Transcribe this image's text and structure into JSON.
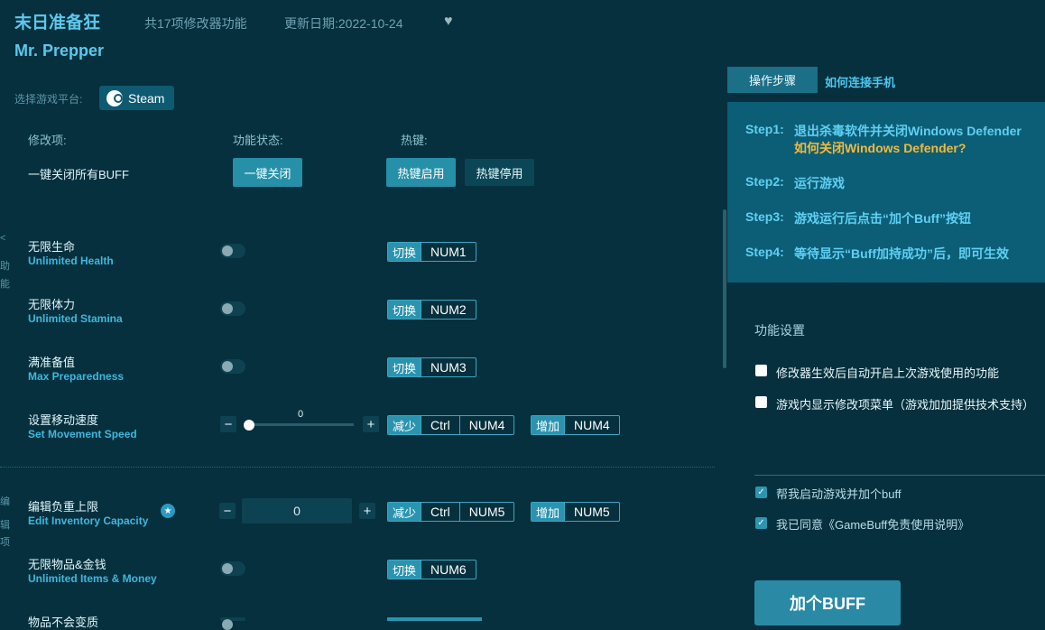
{
  "header": {
    "title": "末日准备狂",
    "subtitle": "Mr. Prepper",
    "feature_count": "共17项修改器功能",
    "update_date": "更新日期:2022-10-24"
  },
  "platform": {
    "label": "选择游戏平台:",
    "name": "Steam"
  },
  "columns": {
    "item": "修改项:",
    "status": "功能状态:",
    "hotkey": "热键:"
  },
  "master": {
    "label": "一键关闭所有BUFF",
    "close_all": "一键关闭",
    "hotkey_on": "热键启用",
    "hotkey_off": "热键停用"
  },
  "edge_chars": [
    "<",
    "助",
    "能",
    "编",
    "辑",
    "项"
  ],
  "rows": [
    {
      "cn": "无限生命",
      "en": "Unlimited Health",
      "tag": "切换",
      "key": "NUM1"
    },
    {
      "cn": "无限体力",
      "en": "Unlimited Stamina",
      "tag": "切换",
      "key": "NUM2"
    },
    {
      "cn": "满准备值",
      "en": "Max Preparedness",
      "tag": "切换",
      "key": "NUM3"
    },
    {
      "cn": "设置移动速度",
      "en": "Set Movement Speed",
      "value": "0",
      "dec_tag": "减少",
      "dec_mod": "Ctrl",
      "dec_key": "NUM4",
      "inc_tag": "增加",
      "inc_key": "NUM4",
      "slider_fraction": 0
    },
    {
      "cn": "编辑负重上限",
      "en": "Edit Inventory Capacity",
      "value": "0",
      "dec_tag": "减少",
      "dec_mod": "Ctrl",
      "dec_key": "NUM5",
      "inc_tag": "增加",
      "inc_key": "NUM5"
    },
    {
      "cn": "无限物品&金钱",
      "en": "Unlimited Items & Money",
      "tag": "切换",
      "key": "NUM6"
    },
    {
      "cn": "物品不会变质",
      "en": ""
    }
  ],
  "stepper": {
    "minus": "−",
    "plus": "+"
  },
  "right": {
    "tab_steps": "操作步骤",
    "tab_phone": "如何连接手机",
    "steps": [
      {
        "label": "Step1:",
        "text": "退出杀毒软件并关闭Windows Defender",
        "link": "如何关闭Windows Defender?"
      },
      {
        "label": "Step2:",
        "text": "运行游戏"
      },
      {
        "label": "Step3:",
        "text": "游戏运行后点击“加个Buff”按钮"
      },
      {
        "label": "Step4:",
        "text": "等待显示“Buff加持成功”后，即可生效"
      }
    ],
    "settings_title": "功能设置",
    "options": [
      {
        "text": "修改器生效后自动开启上次游戏使用的功能",
        "checked": false
      },
      {
        "text": "游戏内显示修改项菜单（游戏加加提供技术支持）",
        "checked": false
      }
    ],
    "agreements": [
      {
        "text": "帮我启动游戏并加个buff",
        "checked": true
      },
      {
        "text": "我已同意《GameBuff免责使用说明》",
        "checked": true
      }
    ],
    "buff_button": "加个BUFF"
  },
  "icons": {
    "heart": "heart-icon",
    "steam": "steam-icon",
    "star": "star-icon",
    "check": "check-icon"
  }
}
